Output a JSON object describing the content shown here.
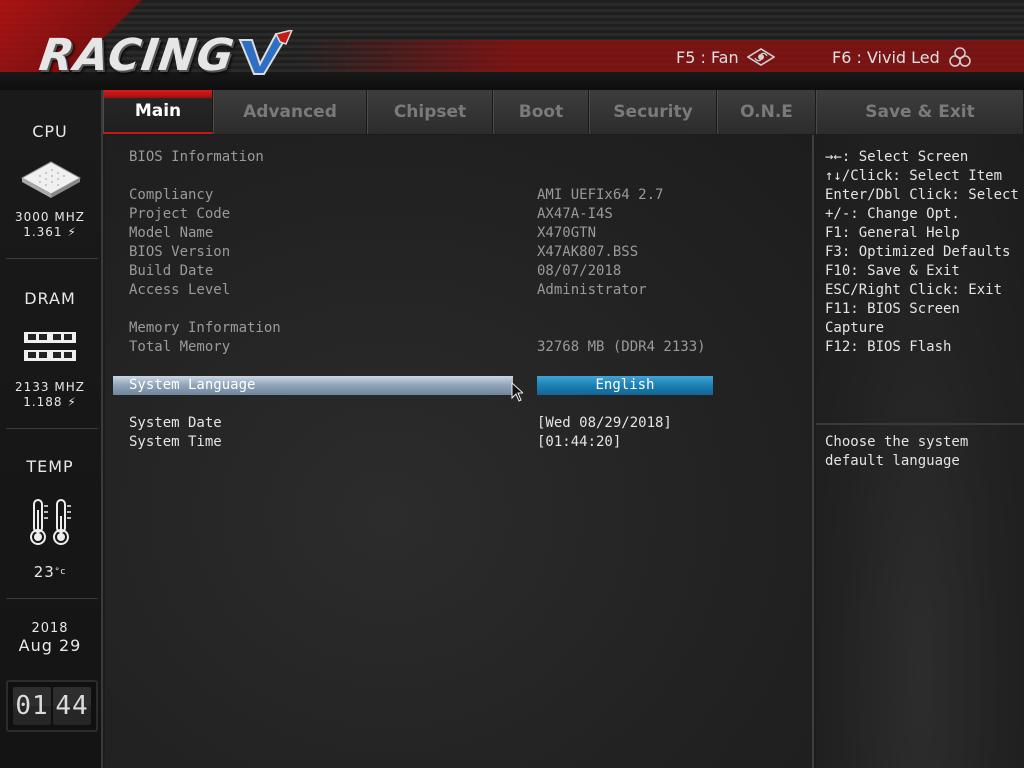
{
  "header": {
    "logo_text": "RACING",
    "hotkeys": [
      {
        "label": "F5 : Fan",
        "icon": "fan-icon"
      },
      {
        "label": "F6 : Vivid Led",
        "icon": "led-icon"
      }
    ]
  },
  "sidebar": {
    "cpu": {
      "title": "CPU",
      "freq": "3000 MHZ",
      "volt": "1.361"
    },
    "dram": {
      "title": "DRAM",
      "freq": "2133 MHZ",
      "volt": "1.188"
    },
    "temp": {
      "title": "TEMP",
      "value": "23"
    },
    "date": {
      "year": "2018",
      "monthday": "Aug 29"
    },
    "clock": {
      "hours": "01",
      "minutes": "44"
    }
  },
  "tabs": [
    {
      "label": "Main",
      "active": true
    },
    {
      "label": "Advanced"
    },
    {
      "label": "Chipset"
    },
    {
      "label": "Boot"
    },
    {
      "label": "Security"
    },
    {
      "label": "O.N.E"
    },
    {
      "label": "Save & Exit"
    }
  ],
  "main": {
    "bios_info_label": "BIOS Information",
    "rows": [
      {
        "label": "Compliancy",
        "value": "AMI UEFIx64 2.7"
      },
      {
        "label": "Project Code",
        "value": "AX47A-I4S"
      },
      {
        "label": "Model Name",
        "value": "X470GTN"
      },
      {
        "label": "BIOS Version",
        "value": "X47AK807.BSS"
      },
      {
        "label": "Build Date",
        "value": "08/07/2018"
      },
      {
        "label": "Access Level",
        "value": "Administrator"
      }
    ],
    "memory_info_label": "Memory Information",
    "total_memory": {
      "label": "Total Memory",
      "value": "32768 MB (DDR4 2133)"
    },
    "system_language": {
      "label": "System Language",
      "value": "English"
    },
    "system_date": {
      "label": "System Date",
      "value": "[Wed 08/29/2018]"
    },
    "system_time": {
      "label": "System Time",
      "value": "[01:44:20]"
    }
  },
  "help": {
    "keys": [
      "→←: Select Screen",
      "↑↓/Click: Select Item",
      "Enter/Dbl Click: Select",
      "+/-: Change Opt.",
      "F1: General Help",
      "F3: Optimized Defaults",
      "F10: Save & Exit",
      "ESC/Right Click: Exit",
      "F11: BIOS Screen",
      "Capture",
      "F12: BIOS Flash"
    ],
    "description": [
      "Choose the system",
      "default language"
    ]
  },
  "colors": {
    "accent_red": "#cc1515",
    "selection_blue": "#1c7fb6",
    "highlight_row": "#8ea3b8"
  }
}
